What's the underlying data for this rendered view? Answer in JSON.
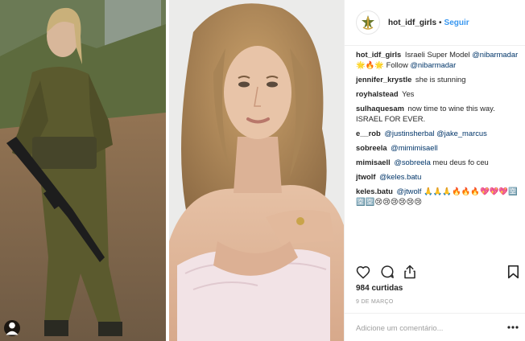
{
  "post": {
    "username": "hot_idf_girls",
    "separator": "•",
    "follow_label": "Seguir",
    "likes_text": "984 curtidas",
    "date_text": "9 DE MARÇO",
    "comment_placeholder": "Adicione um comentário...",
    "images": [
      "photo-soldier",
      "photo-model-portrait"
    ],
    "multi_photo_icon": "user-tag-icon"
  },
  "comments": [
    {
      "user": "hot_idf_girls",
      "text": "Israeli Super Model ",
      "mention": "@nibarmadar",
      "text2": " 🌟🔥🌟 Follow ",
      "mention2": "@nibarmadar"
    },
    {
      "user": "jennifer_krystle",
      "text": "she is stunning"
    },
    {
      "user": "royhalstead",
      "text": "Yes"
    },
    {
      "user": "sulhaquesam",
      "text": "now time to wine this way. ISRAEL FOR EVER."
    },
    {
      "user": "e__rob",
      "mention": "@justinsherbal",
      "mention2": "@jake_marcus"
    },
    {
      "user": "sobreela",
      "mention": "@mimimisaell"
    },
    {
      "user": "mimisaell",
      "mention": "@sobreela",
      "text2": " meu deus fo ceu"
    },
    {
      "user": "jtwolf",
      "mention": "@keles.batu"
    },
    {
      "user": "keles.batu",
      "mention": "@jtwolf",
      "text2": " 🙏🙏🙏🔥🔥🔥💖💖💖🈳🈳🈳😢😢😢😢😢😢"
    }
  ],
  "icons": {
    "avatar": "idf-emblem-icon",
    "like": "heart-icon",
    "comment": "comment-bubble-icon",
    "share": "share-icon",
    "save": "bookmark-icon",
    "more": "more-options-icon"
  },
  "colors": {
    "link": "#3897f0",
    "mention": "#003569",
    "text": "#262626",
    "muted": "#999999",
    "border": "#efefef"
  }
}
